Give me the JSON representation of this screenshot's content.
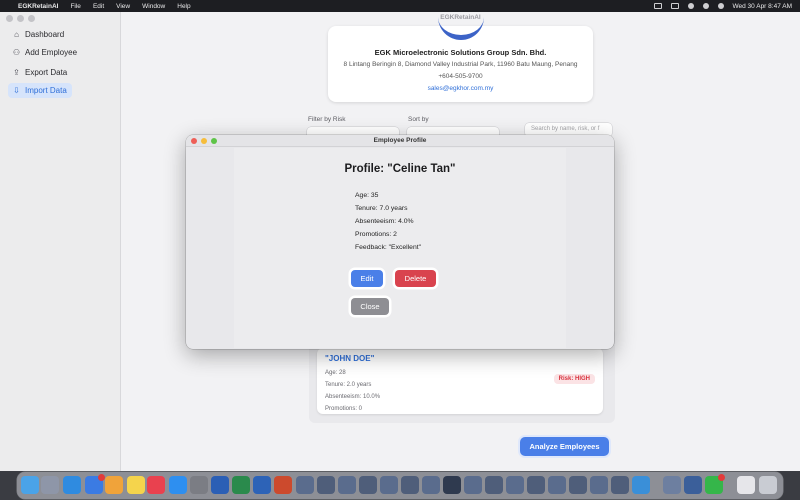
{
  "menubar": {
    "app_name": "EGKRetainAI",
    "menus": [
      "File",
      "Edit",
      "View",
      "Window",
      "Help"
    ],
    "datetime": "Wed 30 Apr  8:47 AM"
  },
  "app": {
    "title": "EGKRetainAI"
  },
  "sidebar": {
    "items": [
      {
        "label": "Dashboard",
        "icon": "house-icon"
      },
      {
        "label": "Add Employee",
        "icon": "person-add-icon"
      },
      {
        "label": "Export Data",
        "icon": "share-icon"
      },
      {
        "label": "Import Data",
        "icon": "import-icon"
      }
    ],
    "active_color": "#2f6fd8"
  },
  "company": {
    "name": "EGK Microelectronic Solutions Group Sdn. Bhd.",
    "address": "8 Lintang Beringin 8, Diamond Valley Industrial Park, 11960 Batu Maung, Penang",
    "phone": "+604-505-9700",
    "email": "sales@egkhor.com.my"
  },
  "filters": {
    "risk_label": "Filter by Risk",
    "sort_label": "Sort by",
    "search_placeholder": "Search by name, risk, or f"
  },
  "employee_card": {
    "name": "\"JOHN DOE\"",
    "age": "Age: 28",
    "tenure": "Tenure: 2.0 years",
    "absenteeism": "Absenteeism: 10.0%",
    "promotions": "Promotions: 0",
    "risk": "Risk: HIGH"
  },
  "analyze_button": "Analyze Employees",
  "modal": {
    "window_title": "Employee Profile",
    "profile_title": "Profile: \"Celine Tan\"",
    "age": "Age: 35",
    "tenure": "Tenure: 7.0 years",
    "absenteeism": "Absenteeism: 4.0%",
    "promotions": "Promotions: 2",
    "feedback": "Feedback: \"Excellent\"",
    "edit_label": "Edit",
    "delete_label": "Delete",
    "close_label": "Close"
  },
  "colors": {
    "accent": "#4a7fe8",
    "danger": "#d9434e",
    "neutral": "#8e8e93"
  }
}
